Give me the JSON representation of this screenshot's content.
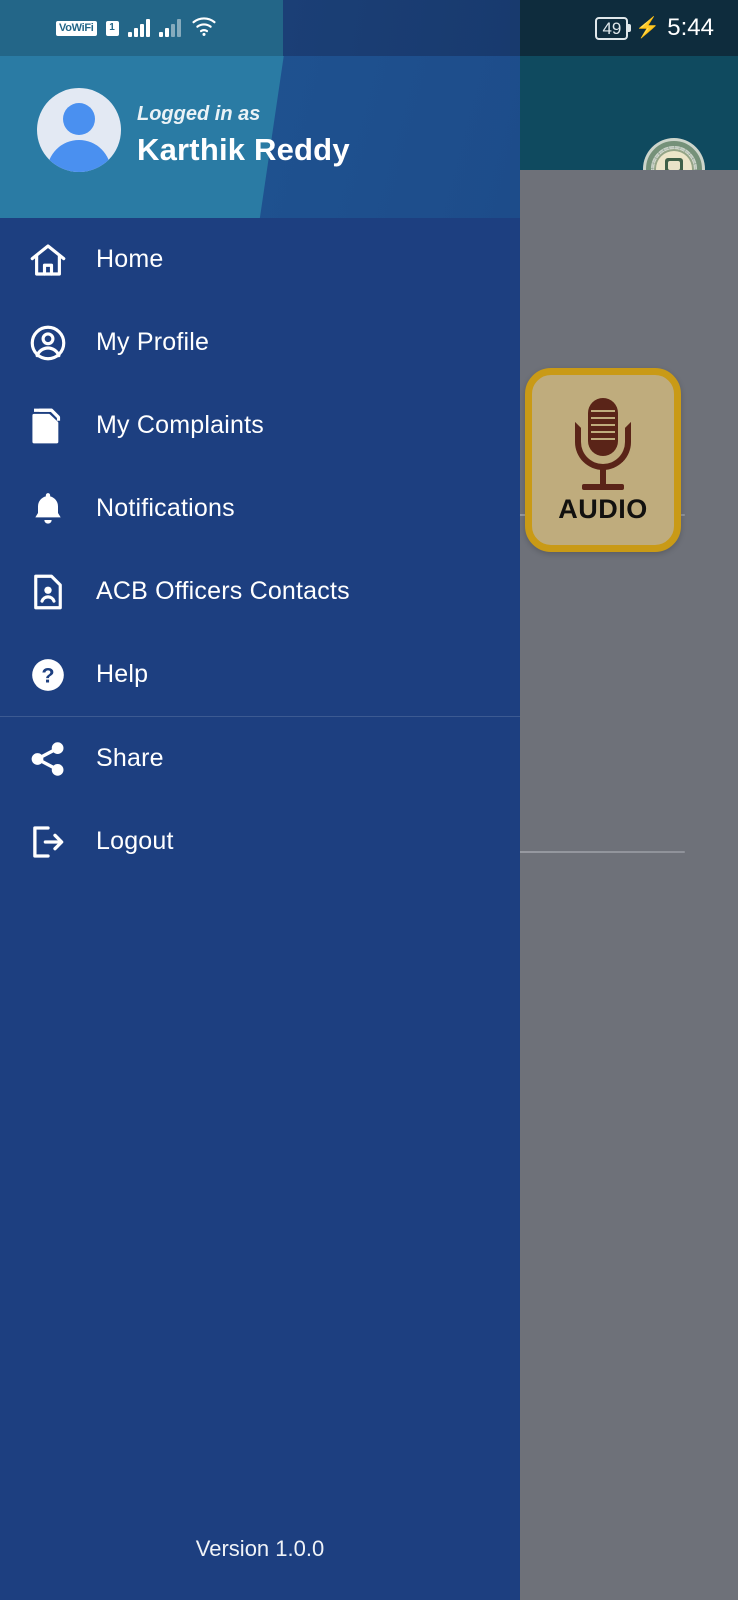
{
  "status_bar": {
    "vowifi_label": "VoWiFi",
    "sim_label": "1",
    "signal_1_icon": "signal-bars-icon",
    "signal_2_icon": "signal-bars-weak-icon",
    "wifi_icon": "wifi-icon",
    "battery_percent": "49",
    "charging_icon": "charging-bolt-icon",
    "time": "5:44"
  },
  "drawer": {
    "logged_in_label": "Logged in as",
    "user_name": "Karthik Reddy",
    "avatar_icon": "avatar-person-icon",
    "version": "Version 1.0.0",
    "items": [
      {
        "label": "Home",
        "icon": "home-icon"
      },
      {
        "label": "My Profile",
        "icon": "account-circle-icon"
      },
      {
        "label": "My Complaints",
        "icon": "documents-copy-icon"
      },
      {
        "label": "Notifications",
        "icon": "bell-icon"
      },
      {
        "label": "ACB Officers Contacts",
        "icon": "contact-card-icon"
      },
      {
        "label": "Help",
        "icon": "help-circle-icon"
      },
      {
        "label": "Share",
        "icon": "share-nodes-icon"
      },
      {
        "label": "Logout",
        "icon": "logout-arrow-icon"
      }
    ]
  },
  "background_app": {
    "emblem_icon": "ap-government-emblem-icon",
    "audio_card": {
      "label": "AUDIO",
      "icon": "microphone-icon"
    }
  },
  "colors": {
    "drawer_bg": "#1d3f80",
    "drawer_header_teal": "#2a7ba4",
    "drawer_header_blue": "#1f5290",
    "scrim_grey": "#6e7179",
    "appbar_teal": "#0f4a5f",
    "statusbar_dark": "#0e2c3d",
    "audio_card_bg": "#bfac7d",
    "audio_card_border": "#c99a16",
    "audio_icon_brown": "#5a2418",
    "avatar_blue": "#4a90f0"
  }
}
